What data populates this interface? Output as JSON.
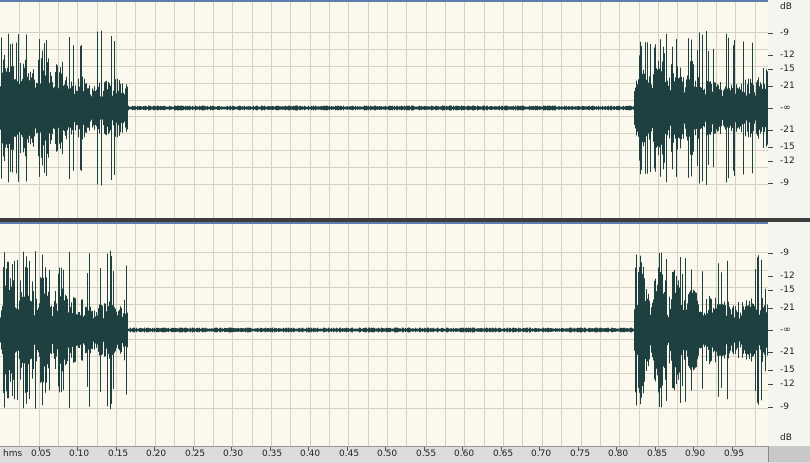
{
  "ruler": {
    "unit": "dB",
    "channel_labels": [
      "-9",
      "-12",
      "-15",
      "-21",
      "-∞",
      "-21",
      "-15",
      "-12",
      "-9"
    ]
  },
  "timeline": {
    "unit": "hms",
    "labels": [
      "0.05",
      "0.10",
      "0.15",
      "0.20",
      "0.25",
      "0.30",
      "0.35",
      "0.40",
      "0.45",
      "0.50",
      "0.55",
      "0.60",
      "0.65",
      "0.70",
      "0.75",
      "0.80",
      "0.85",
      "0.90",
      "0.95"
    ]
  },
  "colors": {
    "wave": "#1e4040",
    "background": "#fbf9ee",
    "grid": "#d5d2c4"
  }
}
